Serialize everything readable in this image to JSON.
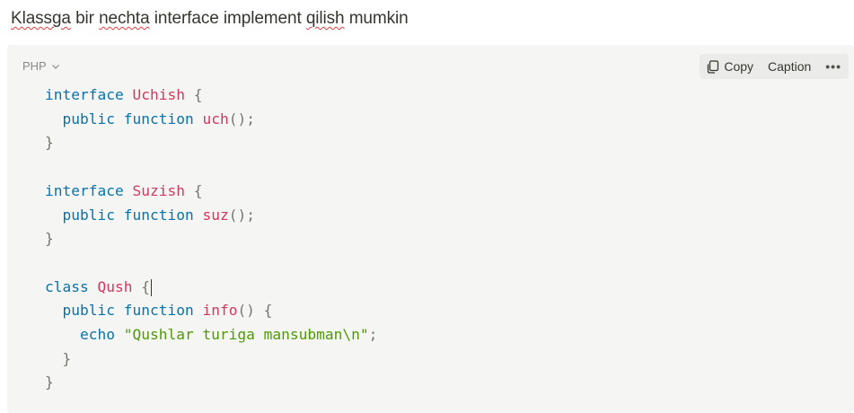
{
  "heading": {
    "parts": [
      "Klassga",
      " bir ",
      "nechta",
      " interface implement ",
      "qilish",
      " mumkin"
    ]
  },
  "code_block": {
    "language": "PHP",
    "toolbar": {
      "copy_label": "Copy",
      "caption_label": "Caption",
      "more_label": "•••"
    },
    "lines": {
      "l1": [
        "interface",
        " ",
        "Uchish",
        " {"
      ],
      "l2": [
        "  ",
        "public",
        " ",
        "function",
        " ",
        "uch",
        "();"
      ],
      "l3": [
        "}"
      ],
      "l5": [
        "interface",
        " ",
        "Suzish",
        " {"
      ],
      "l6": [
        "  ",
        "public",
        " ",
        "function",
        " ",
        "suz",
        "();"
      ],
      "l7": [
        "}"
      ],
      "l9": [
        "class",
        " ",
        "Qush",
        " {"
      ],
      "l10": [
        "  ",
        "public",
        " ",
        "function",
        " ",
        "info",
        "() {"
      ],
      "l11": [
        "    ",
        "echo",
        " ",
        "\"Qushlar turiga mansubman\\n\"",
        ";"
      ],
      "l12": [
        "  }"
      ],
      "l13": [
        "}"
      ]
    }
  },
  "colors": {
    "keyword": "#0b72a9",
    "name": "#d3385f",
    "punct": "#77756f",
    "string": "#4e9a06",
    "spellcheck": "#e03e3e"
  }
}
